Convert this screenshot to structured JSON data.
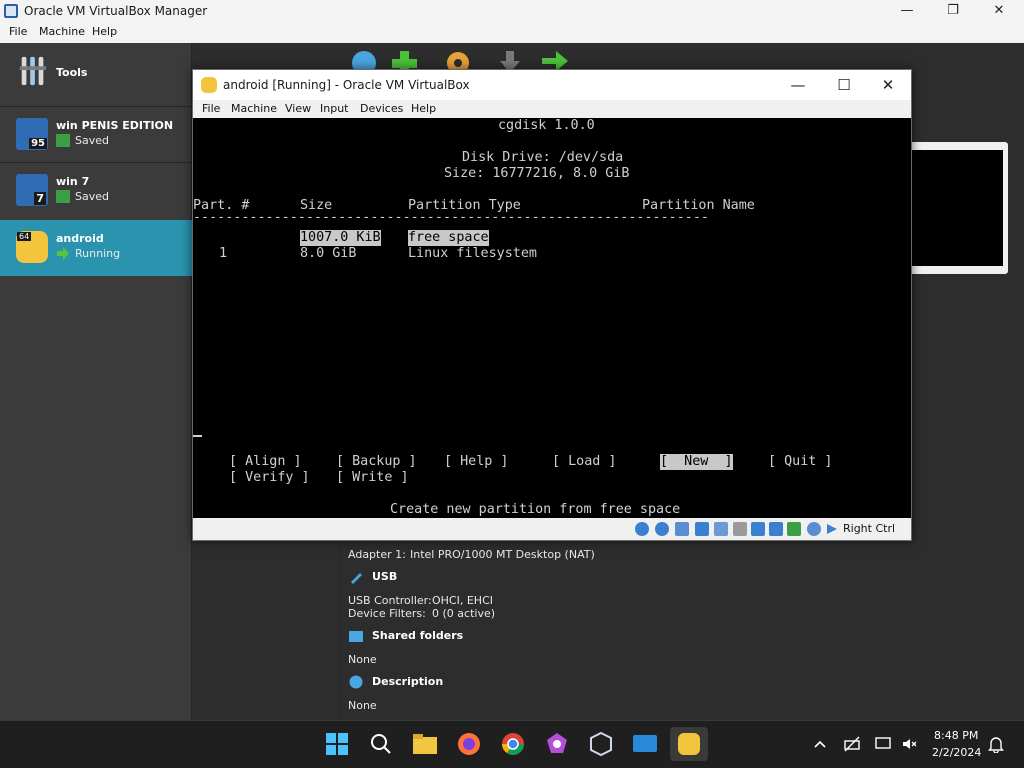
{
  "manager": {
    "title": "Oracle VM VirtualBox Manager",
    "menu": [
      "File",
      "Machine",
      "Help"
    ],
    "tools_label": "Tools",
    "vms": [
      {
        "name": "win PENIS EDITION",
        "state": "Saved",
        "badge": "95"
      },
      {
        "name": "win 7",
        "state": "Saved",
        "badge": "7"
      },
      {
        "name": "android",
        "state": "Running",
        "badge": "64"
      }
    ],
    "details": {
      "adapter_label": "Adapter 1:",
      "adapter_value": "Intel PRO/1000 MT Desktop (NAT)",
      "usb_title": "USB",
      "usb_controller_label": "USB Controller:",
      "usb_controller_value": "OHCI, EHCI",
      "device_filters_label": "Device Filters:",
      "device_filters_value": "0 (0 active)",
      "shared_title": "Shared folders",
      "shared_value": "None",
      "desc_title": "Description",
      "desc_value": "None"
    }
  },
  "vm_window": {
    "title": "android [Running] - Oracle VM VirtualBox",
    "menu": [
      "File",
      "Machine",
      "View",
      "Input",
      "Devices",
      "Help"
    ],
    "host_key": "Right Ctrl"
  },
  "terminal": {
    "app": "cgdisk 1.0.0",
    "drive": "Disk Drive: /dev/sda",
    "size": "Size: 16777216, 8.0 GiB",
    "header_part": "Part. #",
    "header_size": "Size",
    "header_type": "Partition Type",
    "header_name": "Partition Name",
    "divider": "----------------------------------------------------------------",
    "rows": [
      {
        "part": "",
        "size": "1007.0 KiB",
        "type": "free space",
        "name": ""
      },
      {
        "part": "1",
        "size": "8.0 GiB",
        "type": "Linux filesystem",
        "name": ""
      }
    ],
    "menu_row1": [
      "[ Align ]",
      "[ Backup ]",
      "[ Help ]",
      "[ Load ]",
      "[  New  ]",
      "[ Quit ]"
    ],
    "menu_row2": [
      "[ Verify ]",
      "[ Write ]"
    ],
    "selected_action": "New",
    "hint": "Create new partition from free space"
  },
  "taskbar": {
    "time": "8:48 PM",
    "date": "2/2/2024"
  },
  "colors": {
    "selection": "#2a93ae",
    "terminal_bg": "#000000",
    "terminal_fg": "#d0d0d0",
    "highlight_bg": "#c8c8c8"
  }
}
